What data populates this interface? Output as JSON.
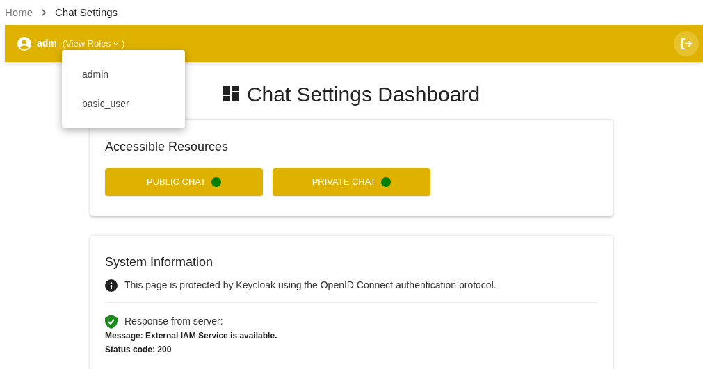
{
  "breadcrumb": [
    {
      "label": "Home",
      "selected": false
    },
    {
      "label": "Chat Settings",
      "selected": true
    }
  ],
  "header": {
    "user": "adm",
    "roles_toggle": "(View Roles",
    "roles_close": ")",
    "roles_expanded": true,
    "roles": [
      "admin",
      "basic_user"
    ]
  },
  "title": "Chat Settings Dashboard",
  "resources": {
    "heading": "Accessible Resources",
    "items": [
      {
        "label": "PUBLIC CHAT",
        "color": "#008000"
      },
      {
        "label": "PRIVATE CHAT",
        "color": "#008000"
      }
    ]
  },
  "system": {
    "heading": "System Information",
    "notice": "This page is protected by Keycloak using the OpenID Connect authentication protocol.",
    "response_label": "Response from server:",
    "message": "Message: External IAM Service is available.",
    "status": "Status code: 200"
  }
}
